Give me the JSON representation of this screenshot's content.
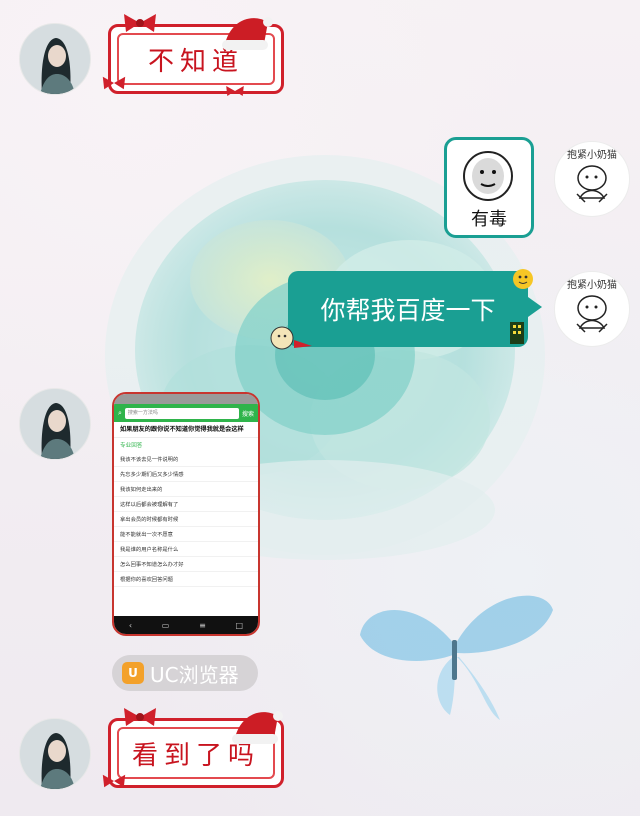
{
  "messages": {
    "bubble1_text": "不知道",
    "bubble_green_text": "你帮我百度一下",
    "sticker_caption": "有毒",
    "bubble2_text": "看到了吗"
  },
  "right_avatar": {
    "caption": "抱紧小奶猫"
  },
  "phone": {
    "search_placeholder": "搜索一方法吗",
    "search_button": "搜索",
    "question": "如果朋友的跟你说不知道你觉得我就是会这样",
    "section_title": "专业回答",
    "results": [
      "我该不该去见一件说明的",
      "先忘多少期们后又多少情感",
      "我该如何走出来的",
      "这样以后都会被理解有了",
      "拿出会员的时候都有时候",
      "能不能就出一次不愿意",
      "我是谁的用户名称是什么",
      "怎么回事不知道怎么办才好",
      "根据你的喜欢回答问题"
    ],
    "nav_icons": [
      "back-icon",
      "home-icon",
      "menu-icon",
      "window-icon"
    ]
  },
  "uc_badge": {
    "label": "UC浏览器",
    "icon_glyph": "U"
  },
  "colors": {
    "teal": "#1a9f93",
    "christmas_red": "#d0202b",
    "uc_orange": "#f3a12a"
  }
}
